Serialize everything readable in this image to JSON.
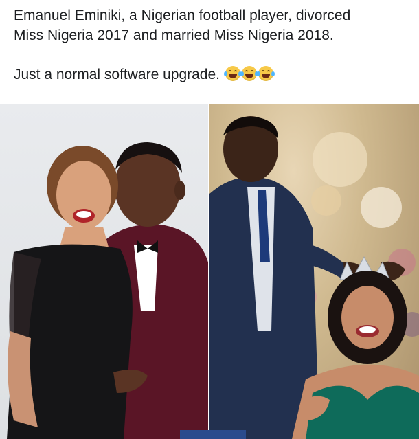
{
  "post": {
    "line1": "Emanuel Eminiki, a Nigerian football player, divorced",
    "line2": "Miss Nigeria 2017 and married Miss Nigeria 2018.",
    "line3": "Just a normal software upgrade.",
    "emojis": [
      "face-with-tears-of-joy-icon",
      "face-with-tears-of-joy-icon",
      "face-with-tears-of-joy-icon"
    ]
  },
  "photos": {
    "left": {
      "subject": "couple-embrace-photo"
    },
    "right": {
      "subject": "crowning-photo"
    }
  },
  "colors": {
    "text": "#1c1e21",
    "left_suit": "#5a1526",
    "right_suit": "#22304f",
    "dress_green": "#0e6b5a"
  }
}
